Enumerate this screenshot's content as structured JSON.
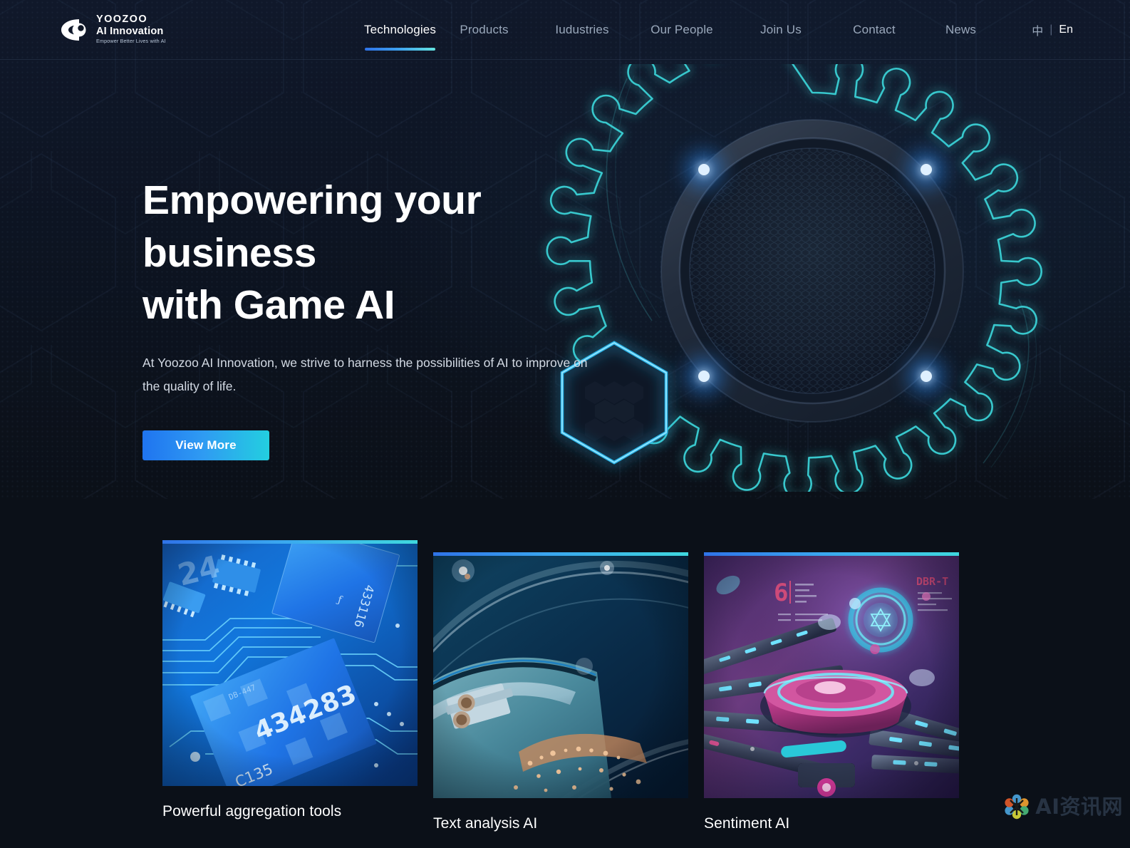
{
  "brand": {
    "logo_icon": "yoozoo-eye-logo-icon",
    "name_line1": "YOOZOO",
    "name_line2": "AI Innovation",
    "tagline": "Empower Better Lives with AI"
  },
  "nav": {
    "items": [
      {
        "label": "Technologies",
        "active": true
      },
      {
        "label": "Products",
        "active": false
      },
      {
        "label": "Iudustries",
        "active": false
      },
      {
        "label": "Our People",
        "active": false
      },
      {
        "label": "Join Us",
        "active": false
      },
      {
        "label": "Contact",
        "active": false
      },
      {
        "label": "News",
        "active": false
      }
    ],
    "lang_cn": "中",
    "lang_sep": "|",
    "lang_en": "En"
  },
  "hero": {
    "title_line1": "Empowering your business",
    "title_line2": "with Game AI",
    "subtitle": "At Yoozoo AI Innovation, we strive to harness the possibilities of AI to improve on the quality of life.",
    "cta_label": "View More",
    "art": {
      "gear_icon": "glowing-gear-icon",
      "hexagon_icon": "glowing-hexagon-icon",
      "disc_icon": "hex-mesh-disc-icon"
    }
  },
  "cards": [
    {
      "title": "Powerful aggregation tools",
      "image_name": "circuit-board-chips-image",
      "image_labels": [
        "24",
        "433116",
        "434283",
        "C135"
      ],
      "accent_from": "#2f73e8",
      "accent_to": "#3fd8de"
    },
    {
      "title": "Text analysis AI",
      "image_name": "industrial-machinery-image",
      "image_labels": [],
      "accent_from": "#2f73e8",
      "accent_to": "#3fd8de"
    },
    {
      "title": "Sentiment AI",
      "image_name": "sci-fi-spacecraft-image",
      "image_labels": [
        "6",
        "DBR-T"
      ],
      "accent_from": "#2f73e8",
      "accent_to": "#3fd8de"
    }
  ],
  "watermark": {
    "icon": "flower-pinwheel-logo-icon",
    "text": "AI资讯网"
  },
  "colors": {
    "background": "#0b1018",
    "hero_background": "#10182a",
    "accent_blue": "#2f73e8",
    "accent_cyan": "#3fd8de",
    "text_primary": "#ffffff",
    "text_muted": "#9aa8bb"
  }
}
